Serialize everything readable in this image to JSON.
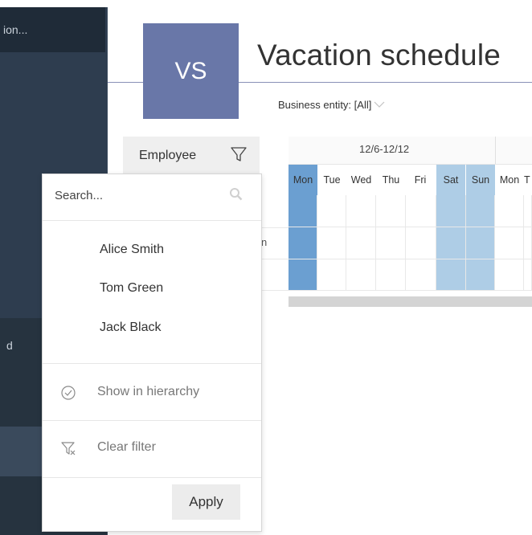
{
  "nav": {
    "top_item": "ion...",
    "partial_item": "d"
  },
  "app": {
    "logo": "VS",
    "title": "Vacation schedule"
  },
  "filters": {
    "business_entity": "Business entity: [All]"
  },
  "table": {
    "employee_header": "Employee",
    "week_label": "12/6-12/12",
    "days": [
      "Mon",
      "Tue",
      "Wed",
      "Thu",
      "Fri",
      "Sat",
      "Sun",
      "Mon",
      "T"
    ],
    "peek_text": "n"
  },
  "popup": {
    "search_placeholder": "Search...",
    "employees": [
      "Alice Smith",
      "Tom Green",
      "Jack Black"
    ],
    "show_hierarchy": "Show in hierarchy",
    "clear_filter": "Clear filter",
    "apply": "Apply"
  },
  "colors": {
    "nav_bg": "#2e3d4f",
    "logo_bg": "#6977a8",
    "today_col": "#6b9fd1",
    "weekend_col": "#aecde6"
  }
}
